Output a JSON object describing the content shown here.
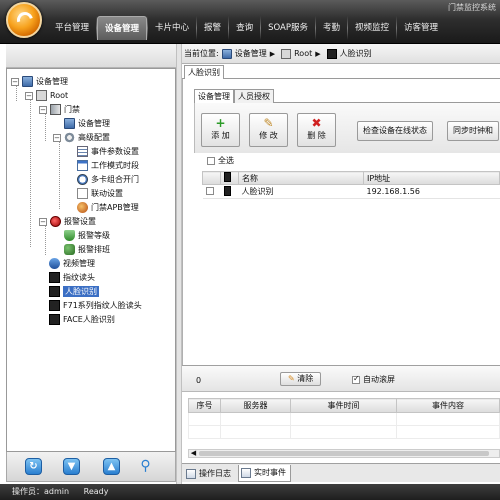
{
  "app": {
    "title": "门禁监控系统",
    "nav": [
      "平台管理",
      "设备管理",
      "卡片中心",
      "报警",
      "查询",
      "SOAP服务",
      "考勤",
      "视频监控",
      "访客管理"
    ],
    "active_nav": "设备管理"
  },
  "tree": {
    "root_label": "设备管理",
    "root_node": "Root",
    "access": "门禁",
    "device_mgmt": "设备管理",
    "advanced": "高级配置",
    "event_params": "事件参数设置",
    "work_mode": "工作模式时段",
    "multi_card": "多卡组合开门",
    "linkage": "联动设置",
    "apb": "门禁APB管理",
    "alarm_settings": "报警设置",
    "alarm_level": "报警等级",
    "alarm_schedule": "报警排班",
    "video_mgmt": "视频管理",
    "fingerprint": "指纹读头",
    "face": "人脸识别",
    "f71": "F71系列指纹人脸读头",
    "face_reader": "FACE人脸识别"
  },
  "breadcrumb": {
    "prefix": "当前位置:",
    "items": [
      "设备管理",
      "Root",
      "人脸识别"
    ]
  },
  "tabs_top": [
    "人脸识别"
  ],
  "tabs_inner": [
    "设备管理",
    "人员授权"
  ],
  "toolbar": {
    "add": "添 加",
    "edit": "修 改",
    "delete": "删 除",
    "check_online": "检查设备在线状态",
    "sync_time": "同步时钟和"
  },
  "select_all": "全选",
  "device_table": {
    "headers": [
      "",
      "",
      "名称",
      "IP地址"
    ],
    "rows": [
      {
        "name": "人脸识别",
        "ip": "192.168.1.56"
      }
    ]
  },
  "events": {
    "count": "0",
    "clear": "清除",
    "autoscroll": "自动滚屏",
    "headers": [
      "序号",
      "服务器",
      "事件时间",
      "事件内容"
    ]
  },
  "bottom_tabs": [
    "操作日志",
    "实时事件"
  ],
  "status": {
    "operator": "操作员：admin",
    "state": "Ready"
  }
}
